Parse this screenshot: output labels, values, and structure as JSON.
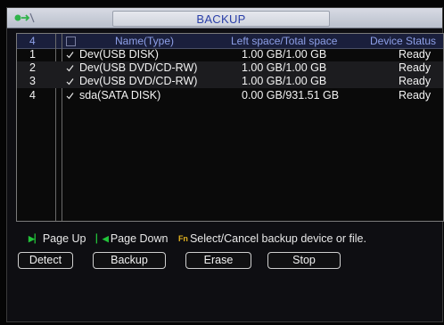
{
  "window": {
    "title": "BACKUP"
  },
  "table": {
    "header": {
      "index": "4",
      "name": "Name(Type)",
      "space": "Left space/Total space",
      "status": "Device Status"
    },
    "rows": [
      {
        "index": "1",
        "name": "Dev(USB DISK)",
        "space": "1.00 GB/1.00 GB",
        "status": "Ready"
      },
      {
        "index": "2",
        "name": "Dev(USB DVD/CD-RW)",
        "space": "1.00 GB/1.00 GB",
        "status": "Ready"
      },
      {
        "index": "3",
        "name": "Dev(USB DVD/CD-RW)",
        "space": "1.00 GB/1.00 GB",
        "status": "Ready"
      },
      {
        "index": "4",
        "name": "sda(SATA DISK)",
        "space": "0.00 GB/931.51 GB",
        "status": "Ready"
      }
    ]
  },
  "hints": {
    "page_up": "Page Up",
    "page_down": "Page Down",
    "select": "Select/Cancel backup device or file.",
    "fn_icon": "Fn"
  },
  "buttons": {
    "detect": "Detect",
    "backup": "Backup",
    "erase": "Erase",
    "stop": "Stop"
  },
  "colors": {
    "title_text": "#2a3fa8",
    "header_text": "#8ea0e8",
    "hint_icon": "#22c33a"
  },
  "icons": {
    "title": "backup-arrow-icon",
    "row_check": "checkmark-icon",
    "page_up": "page-up-icon",
    "page_down": "page-down-icon",
    "fn": "function-key-icon"
  }
}
